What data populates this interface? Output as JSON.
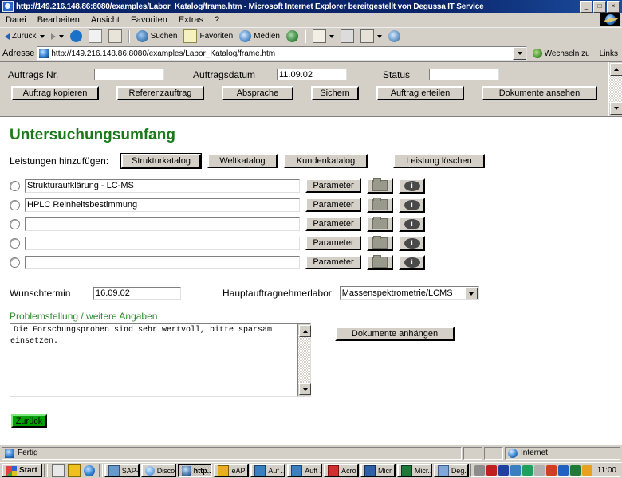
{
  "window": {
    "title": "http://149.216.148.86:8080/examples/Labor_Katalog/frame.htm - Microsoft Internet Explorer bereitgestellt von Degussa IT Service",
    "minimize": "_",
    "maximize": "□",
    "close": "×"
  },
  "menu": {
    "items": [
      "Datei",
      "Bearbeiten",
      "Ansicht",
      "Favoriten",
      "Extras",
      "?"
    ]
  },
  "toolbar": {
    "back": "Zurück",
    "forward": "",
    "stop": "",
    "refresh": "",
    "home": "",
    "search": "Suchen",
    "favorites": "Favoriten",
    "media": "Medien",
    "history": "",
    "mail": "",
    "print": "",
    "edit": "",
    "discuss": ""
  },
  "address": {
    "label": "Adresse",
    "url": "http://149.216.148.86:8080/examples/Labor_Katalog/frame.htm",
    "go": "Wechseln zu",
    "links": "Links"
  },
  "order_header": {
    "auftrag_nr_label": "Auftrags Nr.",
    "auftrag_nr_value": "",
    "auftrag_datum_label": "Auftragsdatum",
    "auftrag_datum_value": "11.09.02",
    "status_label": "Status",
    "status_value": "",
    "buttons": [
      "Auftrag kopieren",
      "Referenzauftrag",
      "Absprache",
      "Sichern",
      "Auftrag erteilen",
      "Dokumente ansehen"
    ]
  },
  "main": {
    "heading": "Untersuchungsumfang",
    "add_label": "Leistungen hinzufügen:",
    "catalog_buttons": [
      "Strukturkatalog",
      "Weltkatalog",
      "Kundenkatalog"
    ],
    "delete_button": "Leistung löschen",
    "service_rows": [
      {
        "value": "Strukturaufklärung - LC-MS",
        "parameter": "Parameter",
        "folder_icon": "folder-icon",
        "info_icon": "info-icon"
      },
      {
        "value": "HPLC Reinheitsbestimmung",
        "parameter": "Parameter",
        "folder_icon": "folder-icon",
        "info_icon": "info-icon"
      },
      {
        "value": "",
        "parameter": "Parameter",
        "folder_icon": "folder-icon",
        "info_icon": "info-icon"
      },
      {
        "value": "",
        "parameter": "Parameter",
        "folder_icon": "folder-icon",
        "info_icon": "info-icon"
      },
      {
        "value": "",
        "parameter": "Parameter",
        "folder_icon": "folder-icon",
        "info_icon": "info-icon"
      }
    ],
    "info_glyph": "i",
    "wunschtermin_label": "Wunschtermin",
    "wunschtermin_value": "16.09.02",
    "hauptlabor_label": "Hauptauftragnehmerlabor",
    "hauptlabor_value": "Massenspektrometrie/LCMS",
    "problem_legend": "Problemstellung / weitere Angaben",
    "problem_text": "Die Forschungsproben sind sehr wertvoll, bitte sparsam\neinsetzen.",
    "attach_button": "Dokumente anhängen",
    "back_button": "Zurück"
  },
  "status": {
    "text": "Fertig",
    "zone": "Internet"
  },
  "taskbar": {
    "start": "Start",
    "tasks": [
      {
        "label": "SAP-...",
        "icon": "sap-icon"
      },
      {
        "label": "Disco...",
        "icon": "disco-icon"
      },
      {
        "label": "http...",
        "icon": "ie-icon",
        "active": true
      },
      {
        "label": "eAP ...",
        "icon": "eap-icon"
      },
      {
        "label": "Auf ...",
        "icon": "auf-icon"
      },
      {
        "label": "Auft ...",
        "icon": "auft-icon"
      },
      {
        "label": "Acro ...",
        "icon": "acrobat-icon"
      },
      {
        "label": "Micr",
        "icon": "word-icon"
      },
      {
        "label": "Micr...",
        "icon": "excel-icon"
      },
      {
        "label": "Deg...",
        "icon": "deg-icon"
      }
    ],
    "clock": "11:00"
  },
  "colors": {
    "chrome": "#d4d0c8",
    "title_blue": "#0a246a",
    "heading_green": "#1a7a1a",
    "button_green": "#00a000"
  }
}
